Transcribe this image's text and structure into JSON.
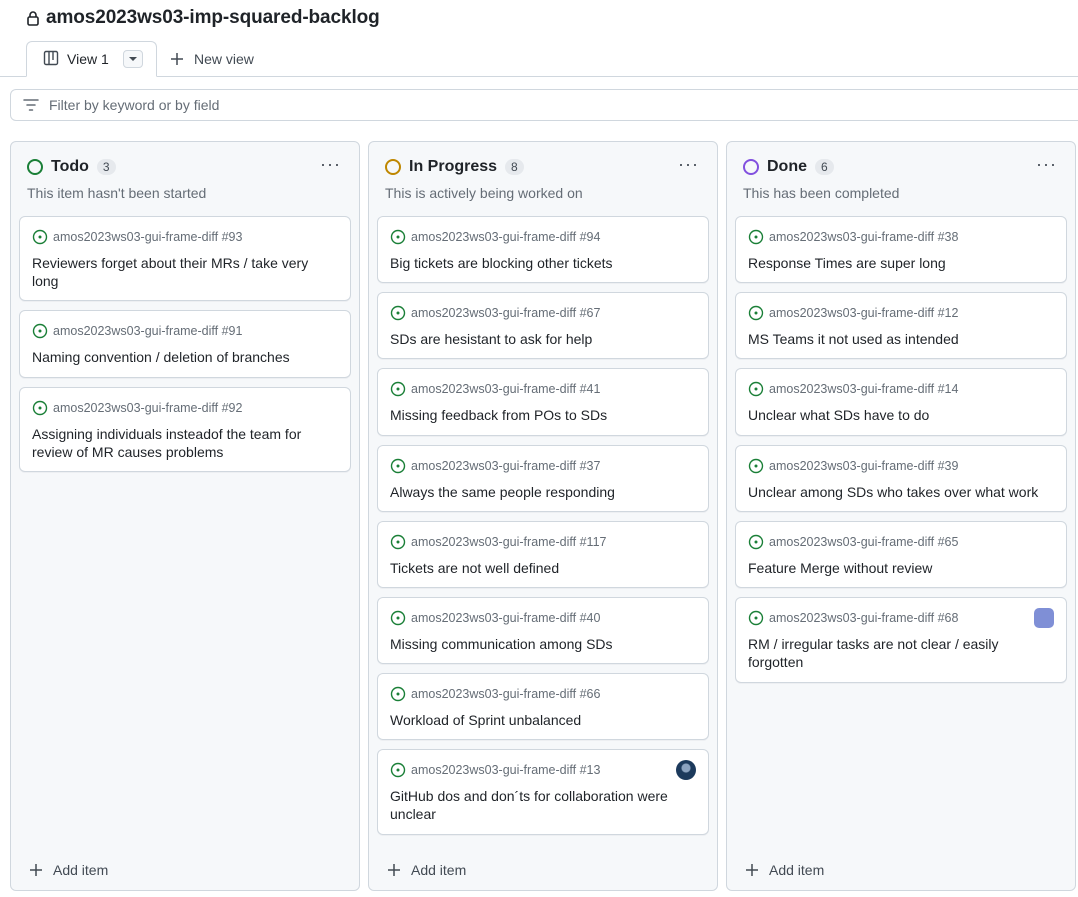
{
  "project": {
    "title": "amos2023ws03-imp-squared-backlog"
  },
  "tabs": {
    "active_label": "View 1",
    "new_view_label": "New view"
  },
  "filter": {
    "placeholder": "Filter by keyword or by field"
  },
  "colors": {
    "todo": "#1a7f37",
    "in_progress": "#bf8700",
    "done": "#8250df",
    "issue_open": "#1a7f37"
  },
  "columns": [
    {
      "name": "Todo",
      "count": "3",
      "description": "This item hasn't been started",
      "add_label": "Add item",
      "cards": [
        {
          "repo": "amos2023ws03-gui-frame-diff #93",
          "title": "Reviewers forget about their MRs / take very long"
        },
        {
          "repo": "amos2023ws03-gui-frame-diff #91",
          "title": "Naming convention / deletion of branches"
        },
        {
          "repo": "amos2023ws03-gui-frame-diff #92",
          "title": "Assigning individuals insteadof the team for review of MR causes problems"
        }
      ]
    },
    {
      "name": "In Progress",
      "count": "8",
      "description": "This is actively being worked on",
      "add_label": "Add item",
      "cards": [
        {
          "repo": "amos2023ws03-gui-frame-diff #94",
          "title": "Big tickets are blocking other tickets"
        },
        {
          "repo": "amos2023ws03-gui-frame-diff #67",
          "title": "SDs are hesistant to ask for help"
        },
        {
          "repo": "amos2023ws03-gui-frame-diff #41",
          "title": "Missing feedback from POs to SDs"
        },
        {
          "repo": "amos2023ws03-gui-frame-diff #37",
          "title": "Always the same people responding"
        },
        {
          "repo": "amos2023ws03-gui-frame-diff #117",
          "title": "Tickets are not well defined"
        },
        {
          "repo": "amos2023ws03-gui-frame-diff #40",
          "title": "Missing communication among SDs"
        },
        {
          "repo": "amos2023ws03-gui-frame-diff #66",
          "title": "Workload of Sprint unbalanced"
        },
        {
          "repo": "amos2023ws03-gui-frame-diff #13",
          "title": "GitHub dos and don´ts for collaboration were unclear"
        }
      ]
    },
    {
      "name": "Done",
      "count": "6",
      "description": "This has been completed",
      "add_label": "Add item",
      "cards": [
        {
          "repo": "amos2023ws03-gui-frame-diff #38",
          "title": "Response Times are super long"
        },
        {
          "repo": "amos2023ws03-gui-frame-diff #12",
          "title": "MS Teams it not used as intended"
        },
        {
          "repo": "amos2023ws03-gui-frame-diff #14",
          "title": "Unclear what SDs have to do"
        },
        {
          "repo": "amos2023ws03-gui-frame-diff #39",
          "title": "Unclear among SDs who takes over what work"
        },
        {
          "repo": "amos2023ws03-gui-frame-diff #65",
          "title": "Feature Merge without review"
        },
        {
          "repo": "amos2023ws03-gui-frame-diff #68",
          "title": "RM / irregular tasks are not clear / easily forgotten"
        }
      ]
    }
  ]
}
